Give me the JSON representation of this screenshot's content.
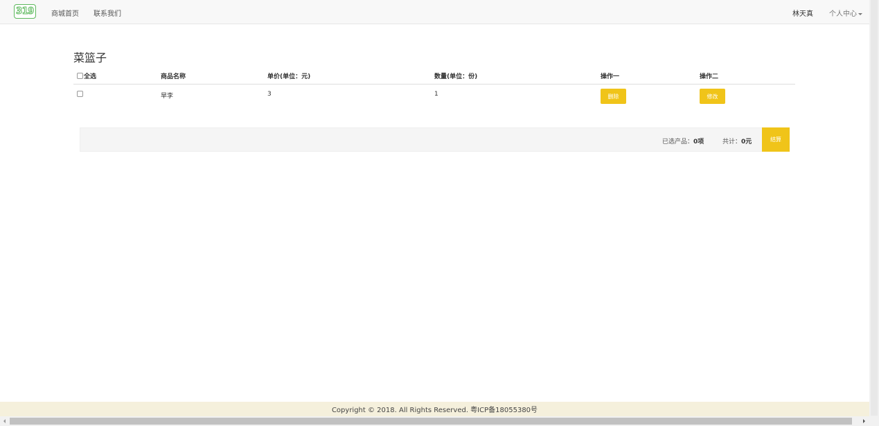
{
  "navbar": {
    "logo_text": "319",
    "links": [
      "商城首页",
      "联系我们"
    ],
    "user_name": "林天真",
    "user_center": "个人中心"
  },
  "page": {
    "title": "菜篮子"
  },
  "table": {
    "select_all": "全选",
    "headers": [
      "商品名称",
      "单价(单位：元)",
      "数量(单位：份)",
      "操作一",
      "操作二"
    ],
    "rows": [
      {
        "name": "旱李",
        "price": "3",
        "quantity": "1",
        "action1": "删除",
        "action2": "修改"
      }
    ]
  },
  "summary": {
    "selected_label": "已选产品：",
    "selected_value": "0项",
    "total_label": "共计：",
    "total_value": "0元",
    "checkout_label": "结算"
  },
  "footer": {
    "copyright": "Copyright © 2018. All Rights Reserved. 粤ICP备18055380号"
  },
  "colors": {
    "accent": "#f0c419",
    "logo": "#5cb85c",
    "footer_bg": "#f5f0dc"
  }
}
